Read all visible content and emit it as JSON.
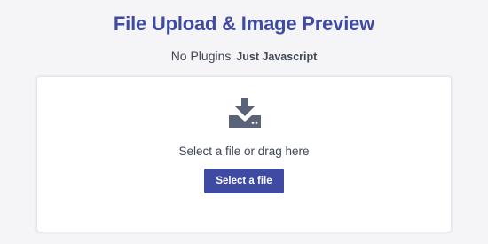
{
  "header": {
    "title": "File Upload & Image Preview",
    "subtitle_regular": "No Plugins",
    "subtitle_strong": "Just Javascript"
  },
  "upload": {
    "icon": "download-tray-icon",
    "prompt": "Select a file or drag here",
    "button_label": "Select a file"
  },
  "colors": {
    "accent": "#3f4aa3",
    "icon": "#5b6378",
    "background": "#f5f5f7",
    "card": "#ffffff"
  }
}
